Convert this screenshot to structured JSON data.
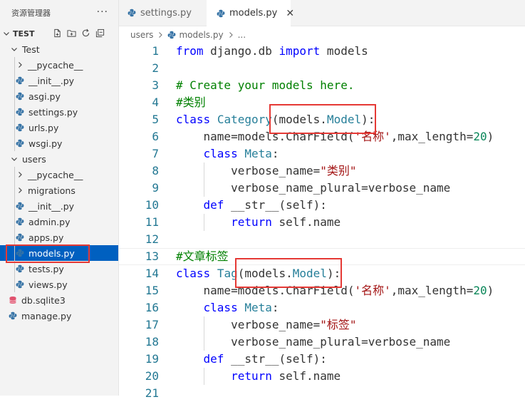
{
  "sidebar": {
    "title": "资源管理器",
    "more": "···",
    "root": "TEST",
    "tree": [
      {
        "label": "Test",
        "kind": "folder-open",
        "depth": 1
      },
      {
        "label": "__pycache__",
        "kind": "folder-closed",
        "depth": 2
      },
      {
        "label": "__init__.py",
        "kind": "python",
        "depth": 2
      },
      {
        "label": "asgi.py",
        "kind": "python",
        "depth": 2
      },
      {
        "label": "settings.py",
        "kind": "python",
        "depth": 2
      },
      {
        "label": "urls.py",
        "kind": "python",
        "depth": 2
      },
      {
        "label": "wsgi.py",
        "kind": "python",
        "depth": 2
      },
      {
        "label": "users",
        "kind": "folder-open",
        "depth": 1
      },
      {
        "label": "__pycache__",
        "kind": "folder-closed",
        "depth": 2
      },
      {
        "label": "migrations",
        "kind": "folder-closed",
        "depth": 2
      },
      {
        "label": "__init__.py",
        "kind": "python",
        "depth": 2
      },
      {
        "label": "admin.py",
        "kind": "python",
        "depth": 2
      },
      {
        "label": "apps.py",
        "kind": "python",
        "depth": 2
      },
      {
        "label": "models.py",
        "kind": "python",
        "depth": 2,
        "selected": true
      },
      {
        "label": "tests.py",
        "kind": "python",
        "depth": 2
      },
      {
        "label": "views.py",
        "kind": "python",
        "depth": 2
      },
      {
        "label": "db.sqlite3",
        "kind": "database",
        "depth": 1
      },
      {
        "label": "manage.py",
        "kind": "python",
        "depth": 1
      }
    ]
  },
  "tabs": [
    {
      "label": "settings.py",
      "active": false
    },
    {
      "label": "models.py",
      "active": true,
      "close": "✕"
    }
  ],
  "breadcrumb": {
    "folder": "users",
    "file": "models.py",
    "more": "..."
  },
  "code": [
    [
      [
        "kw",
        "from"
      ],
      [
        "def",
        " django.db "
      ],
      [
        "kw",
        "import"
      ],
      [
        "def",
        " models"
      ]
    ],
    [],
    [
      [
        "cmt",
        "# Create your models here."
      ]
    ],
    [
      [
        "cmt",
        "#类别"
      ]
    ],
    [
      [
        "kw",
        "class"
      ],
      [
        "def",
        " "
      ],
      [
        "cls",
        "Category"
      ],
      [
        "def",
        "(models."
      ],
      [
        "cls",
        "Model"
      ],
      [
        "def",
        "):"
      ]
    ],
    [
      [
        "def",
        "    name=models.CharField("
      ],
      [
        "str",
        "'名称'"
      ],
      [
        "def",
        ",max_length="
      ],
      [
        "num",
        "20"
      ],
      [
        "def",
        ")"
      ]
    ],
    [
      [
        "def",
        "    "
      ],
      [
        "kw",
        "class"
      ],
      [
        "def",
        " "
      ],
      [
        "cls",
        "Meta"
      ],
      [
        "def",
        ":"
      ]
    ],
    [
      [
        "def",
        "        verbose_name="
      ],
      [
        "str",
        "\"类别\""
      ]
    ],
    [
      [
        "def",
        "        verbose_name_plural=verbose_name"
      ]
    ],
    [
      [
        "def",
        "    "
      ],
      [
        "kw",
        "def"
      ],
      [
        "def",
        " __str__(self):"
      ]
    ],
    [
      [
        "def",
        "        "
      ],
      [
        "kw",
        "return"
      ],
      [
        "def",
        " self.name"
      ]
    ],
    [],
    [
      [
        "cmt",
        "#文章标签"
      ]
    ],
    [
      [
        "kw",
        "class"
      ],
      [
        "def",
        " "
      ],
      [
        "cls",
        "Tag"
      ],
      [
        "def",
        "(models."
      ],
      [
        "cls",
        "Model"
      ],
      [
        "def",
        "):"
      ]
    ],
    [
      [
        "def",
        "    name=models.CharField("
      ],
      [
        "str",
        "'名称'"
      ],
      [
        "def",
        ",max_length="
      ],
      [
        "num",
        "20"
      ],
      [
        "def",
        ")"
      ]
    ],
    [
      [
        "def",
        "    "
      ],
      [
        "kw",
        "class"
      ],
      [
        "def",
        " "
      ],
      [
        "cls",
        "Meta"
      ],
      [
        "def",
        ":"
      ]
    ],
    [
      [
        "def",
        "        verbose_name="
      ],
      [
        "str",
        "\"标签\""
      ]
    ],
    [
      [
        "def",
        "        verbose_name_plural=verbose_name"
      ]
    ],
    [
      [
        "def",
        "    "
      ],
      [
        "kw",
        "def"
      ],
      [
        "def",
        " __str__(self):"
      ]
    ],
    [
      [
        "def",
        "        "
      ],
      [
        "kw",
        "return"
      ],
      [
        "def",
        " self.name"
      ]
    ],
    []
  ],
  "current_line": 13,
  "colors": {
    "keyword": "#0000ff",
    "class": "#267f99",
    "string": "#a31515",
    "number": "#098658",
    "comment": "#008000",
    "line_number": "#237893",
    "selection": "#0060c0",
    "highlight_box": "#e53935"
  }
}
